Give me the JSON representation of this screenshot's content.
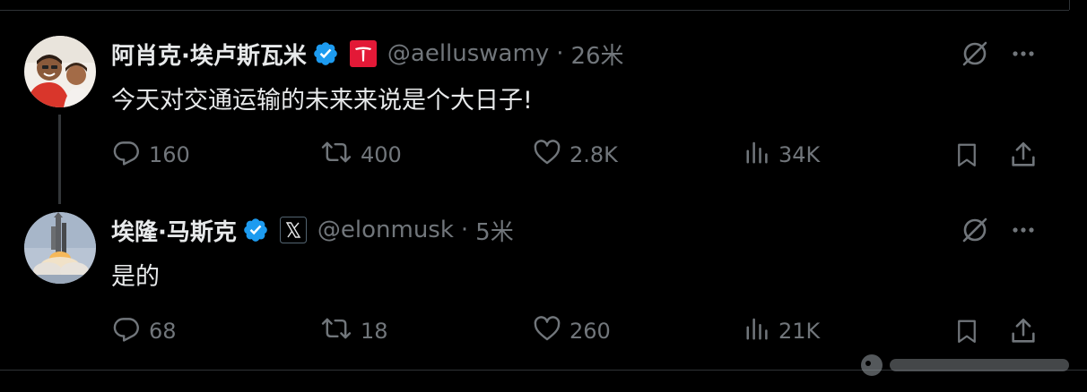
{
  "tweets": [
    {
      "author_name": "阿肖克·埃卢斯瓦米",
      "handle": "@aelluswamy",
      "time": "26米",
      "affiliation_icon": "tesla-logo",
      "text": "今天对交通运输的未来来说是个大日子!",
      "actions": {
        "replies": "160",
        "reposts": "400",
        "likes": "2.8K",
        "views": "34K"
      }
    },
    {
      "author_name": "埃隆·马斯克",
      "handle": "@elonmusk",
      "time": "5米",
      "affiliation_icon": "x-logo",
      "text": "是的",
      "actions": {
        "replies": "68",
        "reposts": "18",
        "likes": "260",
        "views": "21K"
      }
    }
  ],
  "colors": {
    "background": "#000000",
    "text": "#e7e9ea",
    "muted": "#71767b",
    "verified": "#1d9bf0",
    "tesla": "#e31937",
    "divider": "#2f3336"
  },
  "icons": [
    "grok-icon",
    "more-icon",
    "reply-icon",
    "repost-icon",
    "like-icon",
    "views-icon",
    "bookmark-icon",
    "share-icon",
    "verified-badge-icon"
  ]
}
